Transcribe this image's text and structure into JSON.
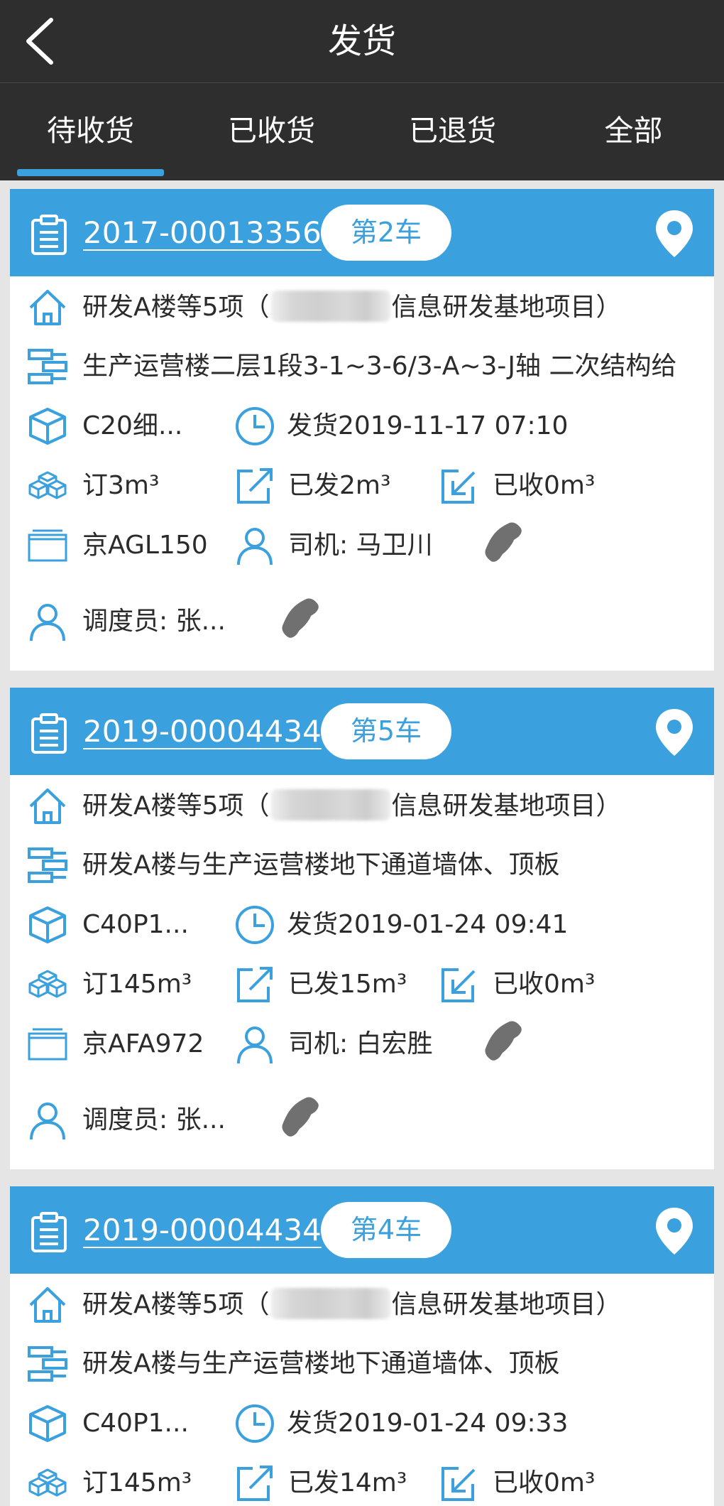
{
  "header": {
    "title": "发货"
  },
  "tabs": [
    {
      "label": "待收货",
      "active": true
    },
    {
      "label": "已收货",
      "active": false
    },
    {
      "label": "已退货",
      "active": false
    },
    {
      "label": "全部",
      "active": false
    }
  ],
  "colors": {
    "accent": "#3aa0de",
    "topbar": "#2e2e2e",
    "background": "#e5e5e5",
    "phone_icon": "#707070"
  },
  "icons": {
    "back": "chevron-left-icon",
    "order": "clipboard-icon",
    "location": "map-pin-icon",
    "project": "house-icon",
    "part": "bricks-icon",
    "material": "cube-icon",
    "time": "clock-icon",
    "ordered": "boxes-icon",
    "sent": "share-out-icon",
    "received": "check-in-icon",
    "plate": "truck-plate-icon",
    "person": "person-icon",
    "phone": "phone-icon"
  },
  "cards": [
    {
      "order_no": "2017-00013356",
      "truck": "第2车",
      "project_prefix": "研发A楼等5项（",
      "project_suffix": "信息研发基地项目）",
      "part": "生产运营楼二层1段3-1~3-6/3-A~3-J轴 二次结构给",
      "material": "C20细...",
      "ship_time": "发货2019-11-17 07:10",
      "ordered": "订3m³",
      "sent": "已发2m³",
      "received": "已收0m³",
      "plate": "京AGL150",
      "driver": "司机: 马卫川",
      "dispatcher": "调度员: 张..."
    },
    {
      "order_no": "2019-00004434",
      "truck": "第5车",
      "project_prefix": "研发A楼等5项（",
      "project_suffix": "信息研发基地项目）",
      "part": "研发A楼与生产运营楼地下通道墙体、顶板",
      "material": "C40P1...",
      "ship_time": "发货2019-01-24 09:41",
      "ordered": "订145m³",
      "sent": "已发15m³",
      "received": "已收0m³",
      "plate": "京AFA972",
      "driver": "司机: 白宏胜",
      "dispatcher": "调度员: 张..."
    },
    {
      "order_no": "2019-00004434",
      "truck": "第4车",
      "project_prefix": "研发A楼等5项（",
      "project_suffix": "信息研发基地项目）",
      "part": "研发A楼与生产运营楼地下通道墙体、顶板",
      "material": "C40P1...",
      "ship_time": "发货2019-01-24 09:33",
      "ordered": "订145m³",
      "sent": "已发14m³",
      "received": "已收0m³"
    }
  ]
}
